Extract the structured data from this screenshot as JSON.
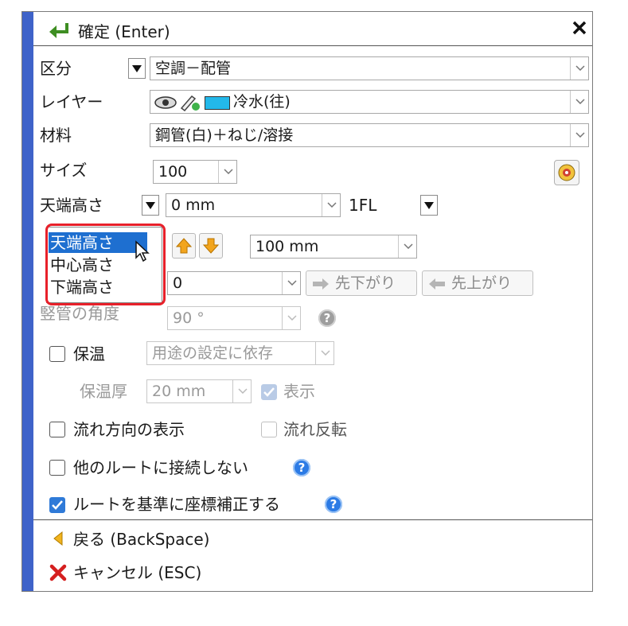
{
  "header": {
    "confirm_label": "確定 (Enter)",
    "close_glyph": "✕"
  },
  "rows": {
    "kubun": {
      "label": "区分",
      "value": "空調－配管"
    },
    "layer": {
      "label": "レイヤー",
      "value": "冷水(往)"
    },
    "material": {
      "label": "材料",
      "value": "鋼管(白)＋ねじ/溶接"
    },
    "size": {
      "label": "サイズ",
      "value": "100"
    },
    "height": {
      "label": "天端高さ",
      "value": "0 mm",
      "ref": "1FL"
    },
    "step": {
      "value": "100 mm"
    },
    "slope": {
      "value": "0",
      "down_label": "先下がり",
      "up_label": "先上がり"
    },
    "vertical": {
      "label": "竪管の角度",
      "value": "90 °"
    }
  },
  "height_menu": {
    "items": [
      "天端高さ",
      "中心高さ",
      "下端高さ"
    ],
    "selected_index": 0
  },
  "insulation": {
    "label": "保温",
    "mode": "用途の設定に依存",
    "thickness_label": "保温厚",
    "thickness": "20 mm",
    "display_label": "表示"
  },
  "options": {
    "flow_direction": "流れ方向の表示",
    "flow_reverse": "流れ反転",
    "no_connect": "他のルートに接続しない",
    "route_correct": "ルートを基準に座標補正する"
  },
  "footer": {
    "back_label": "戻る (BackSpace)",
    "cancel_label": "キャンセル (ESC)"
  },
  "colors": {
    "accent": "#3f63c9",
    "highlight": "#e8202a",
    "selected": "#1e6fd0"
  }
}
